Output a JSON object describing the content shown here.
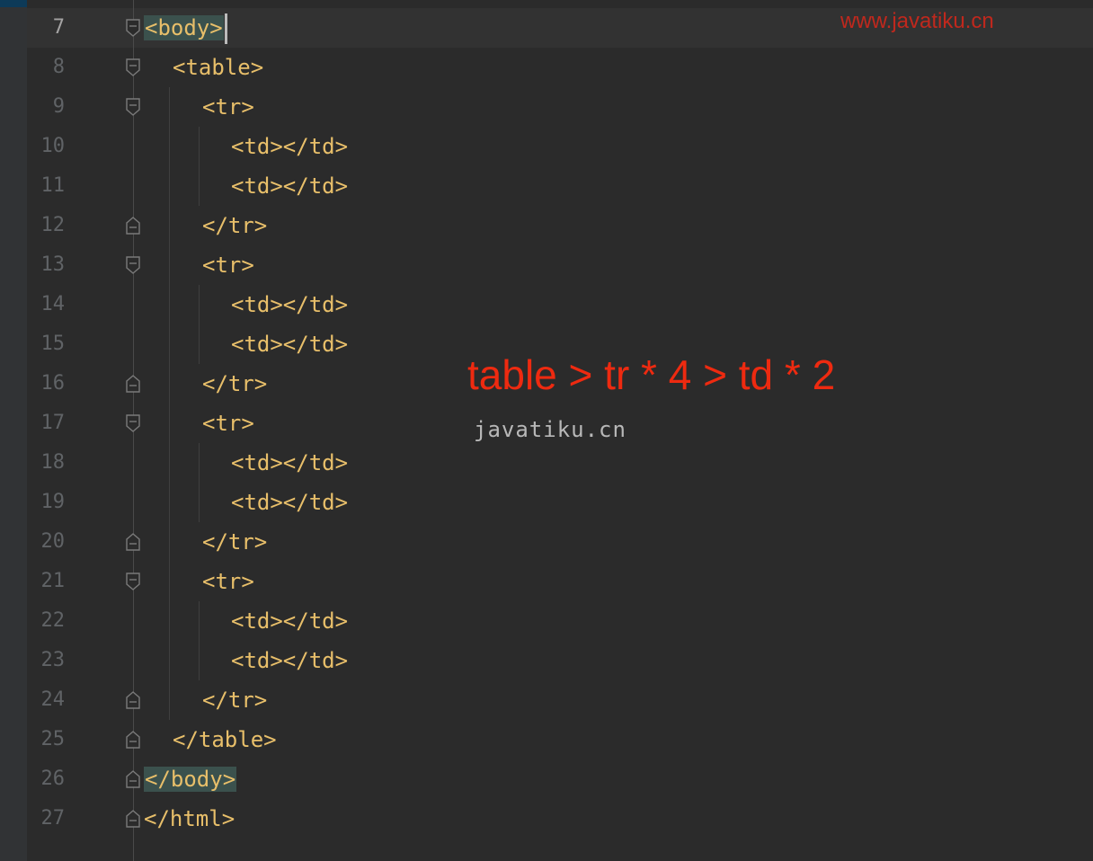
{
  "editor": {
    "lines": [
      {
        "number": "7",
        "code": "<body>",
        "current": true
      },
      {
        "number": "8",
        "code": "<table>"
      },
      {
        "number": "9",
        "code": "<tr>"
      },
      {
        "number": "10",
        "code": "<td></td>"
      },
      {
        "number": "11",
        "code": "<td></td>"
      },
      {
        "number": "12",
        "code": "</tr>"
      },
      {
        "number": "13",
        "code": "<tr>"
      },
      {
        "number": "14",
        "code": "<td></td>"
      },
      {
        "number": "15",
        "code": "<td></td>"
      },
      {
        "number": "16",
        "code": "</tr>"
      },
      {
        "number": "17",
        "code": "<tr>"
      },
      {
        "number": "18",
        "code": "<td></td>"
      },
      {
        "number": "19",
        "code": "<td></td>"
      },
      {
        "number": "20",
        "code": "</tr>"
      },
      {
        "number": "21",
        "code": "<tr>"
      },
      {
        "number": "22",
        "code": "<td></td>"
      },
      {
        "number": "23",
        "code": "<td></td>"
      },
      {
        "number": "24",
        "code": "</tr>"
      },
      {
        "number": "25",
        "code": "</table>"
      },
      {
        "number": "26",
        "code": "</body>"
      },
      {
        "number": "27",
        "code": "</html>"
      }
    ]
  },
  "overlay": {
    "watermark_top": "www.javatiku.cn",
    "annotation": "table > tr * 4 > td * 2",
    "watermark_mid": "javatiku.cn"
  },
  "colors": {
    "background": "#2b2b2b",
    "tag": "#e8bf6a",
    "line_number": "#606366",
    "tag_highlight": "#3b514d",
    "annotation": "#ee2a10",
    "watermark_top": "#c0281d"
  }
}
